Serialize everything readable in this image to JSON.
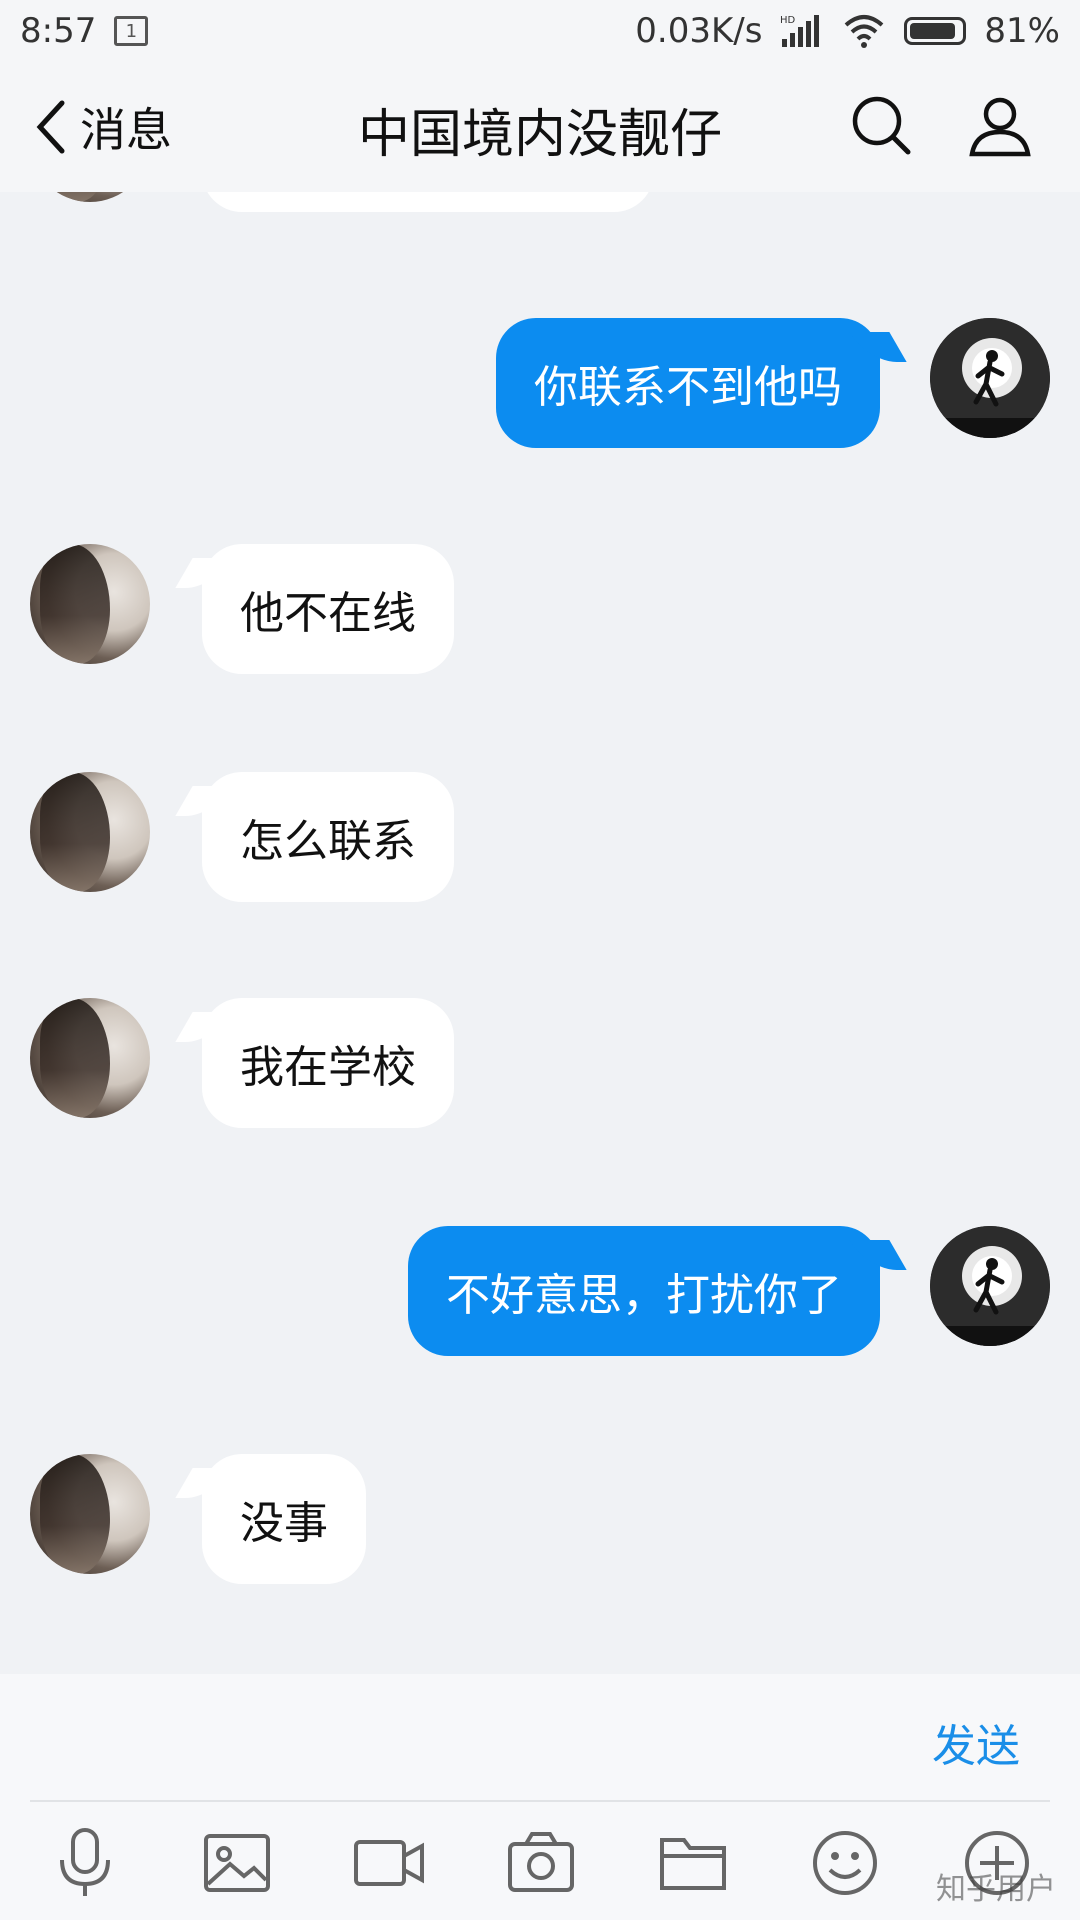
{
  "status_bar": {
    "time": "8:57",
    "calendar_day": "1",
    "network_speed": "0.03K/s",
    "hd_label": "HD",
    "battery": "81%"
  },
  "nav": {
    "back_label": "消息",
    "title": "中国境内没靓仔"
  },
  "messages": [
    {
      "side": "right",
      "text": "你联系不到他吗"
    },
    {
      "side": "left",
      "text": "他不在线"
    },
    {
      "side": "left",
      "text": "怎么联系"
    },
    {
      "side": "left",
      "text": "我在学校"
    },
    {
      "side": "right",
      "text": "不好意思，打扰你了"
    },
    {
      "side": "left",
      "text": "没事"
    }
  ],
  "input": {
    "send_label": "发送"
  },
  "toolbar": {
    "icons": [
      "microphone-icon",
      "image-icon",
      "video-icon",
      "camera-icon",
      "folder-icon",
      "emoji-icon",
      "plus-icon"
    ]
  },
  "watermark": "知乎用户",
  "colors": {
    "outgoing_bubble": "#0c8cf0",
    "incoming_bubble": "#ffffff",
    "send_text": "#1a8ee8",
    "background": "#f0f2f5"
  }
}
